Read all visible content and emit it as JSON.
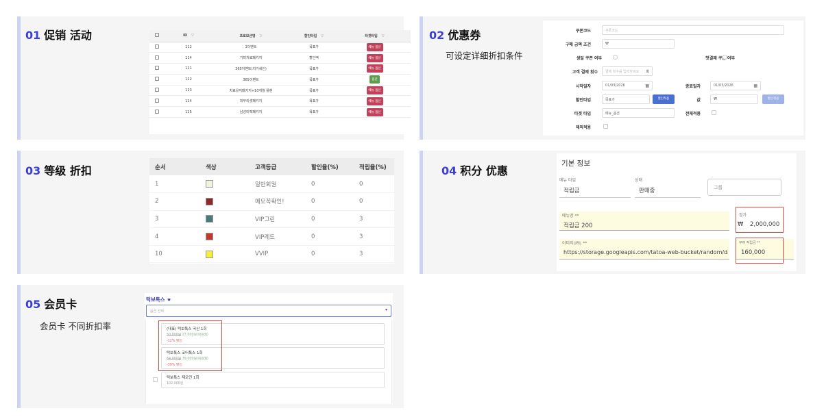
{
  "panels": {
    "p1": {
      "num": "01",
      "title": "促销 活动"
    },
    "p2": {
      "num": "02",
      "title": "优惠券",
      "desc": "可设定详细折扣条件"
    },
    "p3": {
      "num": "03",
      "title": "等级 折扣"
    },
    "p4": {
      "num": "04",
      "title": "积分 优惠"
    },
    "p5": {
      "num": "05",
      "title": "会员卡",
      "desc": "会员卡 不同折扣率"
    }
  },
  "promo_table": {
    "headers": [
      "ID",
      "프로모션명",
      "할인타입",
      "타겟타입"
    ],
    "rows": [
      {
        "id": "112",
        "name": "1이벤트",
        "type": "목표가",
        "target": "메뉴 옵션",
        "target_color": "red"
      },
      {
        "id": "114",
        "name": "기미치료패키지",
        "type": "할인액",
        "target": "메뉴 옵션",
        "target_color": "red"
      },
      {
        "id": "121",
        "name": "365이벤트(치가세인)",
        "type": "목표가",
        "target": "메뉴 옵션",
        "target_color": "red"
      },
      {
        "id": "122",
        "name": "365이벤트",
        "type": "목표가",
        "target": "옵션",
        "target_color": "green"
      },
      {
        "id": "123",
        "name": "치료유지패키지+10개월 플랜",
        "type": "목표가",
        "target": "메뉴 옵션",
        "target_color": "red"
      },
      {
        "id": "124",
        "name": "피부리셋패키지",
        "type": "목표가",
        "target": "메뉴 옵션",
        "target_color": "red"
      },
      {
        "id": "125",
        "name": "남성미백패키지",
        "type": "목표가",
        "target": "메뉴 옵션",
        "target_color": "red"
      }
    ]
  },
  "coupon_form": {
    "coupon_code_label": "쿠폰코드",
    "coupon_code_placeholder": "쿠폰코드",
    "min_amount_label": "구매 금액 조건",
    "currency": "₩",
    "birthday_label": "생일 쿠폰 여부",
    "first_pay_label": "첫결제 쿠폰 여부",
    "pay_count_label": "고객 결제 횟수",
    "pay_count_placeholder": "결제 횟수를 입력하세요.",
    "pay_count_unit": "회",
    "start_label": "시작일자",
    "start_value": "01/03/2026",
    "end_label": "종료일자",
    "end_value": "01/03/2026",
    "discount_type_label": "할인타입",
    "discount_type_value": "목표가",
    "discount_btn": "할인적용",
    "value_label": "값",
    "value_currency": "₩",
    "value_btn": "할인적용",
    "target_type_label": "타겟 타입",
    "target_type_value": "메뉴_옵션",
    "apply_all_label": "전체적용",
    "exclude_label": "제외적용"
  },
  "grade_table": {
    "headers": [
      "순서",
      "색상",
      "고객등급",
      "할인율(%)",
      "적립율(%)"
    ],
    "rows": [
      {
        "order": "1",
        "color": "#eef5dc",
        "grade": "일반회원",
        "discount": "0",
        "accrual": "0"
      },
      {
        "order": "2",
        "color": "#8b2b2b",
        "grade": "메모꼭확인!",
        "discount": "0",
        "accrual": "0"
      },
      {
        "order": "3",
        "color": "#4a7a7a",
        "grade": "VIP그린",
        "discount": "0",
        "accrual": "3"
      },
      {
        "order": "4",
        "color": "#c0392b",
        "grade": "VIP레드",
        "discount": "0",
        "accrual": "3"
      },
      {
        "order": "10",
        "color": "#f5ef3a",
        "grade": "VVIP",
        "discount": "0",
        "accrual": "3"
      }
    ]
  },
  "points_form": {
    "section_title": "기본 정보",
    "menu_type_label": "메뉴 타입",
    "menu_type_value": "적립금",
    "status_label": "상태",
    "status_value": "판매중",
    "group_placeholder": "그룹",
    "menu_name_label": "메뉴명 **",
    "menu_name_value": "적립금 200",
    "price_label": "정가",
    "price_currency": "₩",
    "price_value": "2,000,000",
    "image_url_label": "이미지URL **",
    "image_url_value": "https://storage.googleapis.com/tatoa-web-bucket/random/dark-circle.",
    "accrual_label": "부여 적립금 **",
    "accrual_value": "160,000"
  },
  "member_card": {
    "field_label": "턱보톡스",
    "required_mark": "★",
    "select_placeholder": "옵션 선택",
    "options": [
      {
        "name": "(대표) 턱보톡스 국산 1회",
        "old_price": "50,000원",
        "new_price": "27,000원(회원권)",
        "discount": "-12% 할인"
      },
      {
        "name": "턱보톡스 코어톡스 1회",
        "old_price": "64,000원",
        "new_price": "39,000원(회원권)",
        "discount": "-39% 할인"
      },
      {
        "name": "턱보톡스 제오민 1회",
        "old_price": "",
        "new_price": "102,000원",
        "discount": ""
      }
    ]
  },
  "colors": {
    "accent": "#3a3fd8",
    "panel_bar": "#cfd3f3",
    "highlight_red": "#d94a3f",
    "tag_red": "#c0415a",
    "tag_green": "#5f9a4d"
  }
}
